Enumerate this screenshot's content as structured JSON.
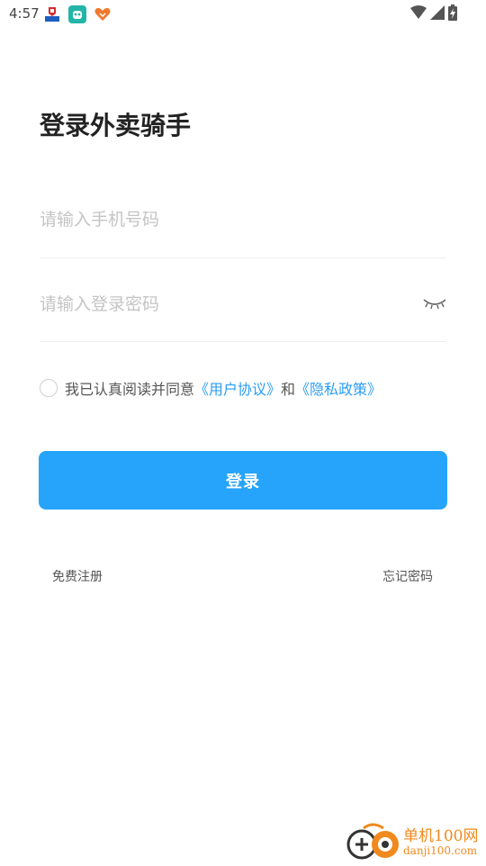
{
  "status_bar": {
    "time": "4:57",
    "notification_icons": [
      "app-icon-flag",
      "app-icon-robot",
      "app-icon-heart"
    ],
    "right_icons": [
      "wifi-icon",
      "cellular-signal-icon",
      "battery-charging-icon"
    ]
  },
  "page": {
    "title": "登录外卖骑手"
  },
  "form": {
    "phone_placeholder": "请输入手机号码",
    "phone_value": "",
    "password_placeholder": "请输入登录密码",
    "password_value": "",
    "password_toggle_icon": "eye-closed-icon"
  },
  "agreement": {
    "prefix": "我已认真阅读并同意",
    "user_agreement": "《用户协议》",
    "conjunction": "和",
    "privacy_policy": "《隐私政策》",
    "checked": false
  },
  "actions": {
    "login_label": "登录",
    "register_label": "免费注册",
    "forgot_label": "忘记密码"
  },
  "watermark": {
    "cn": "单机100网",
    "en": "danji100.com"
  },
  "colors": {
    "primary": "#26a4fb",
    "link": "#2a9df4",
    "placeholder": "#c4c4c4",
    "watermark": "#f08a1f"
  }
}
